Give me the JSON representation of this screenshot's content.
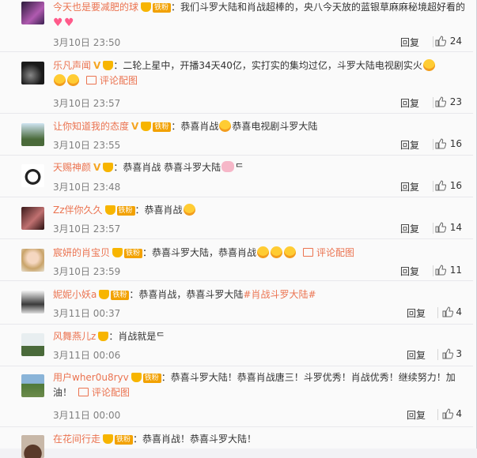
{
  "labels": {
    "reply": "回复",
    "fan_badge": "铁粉",
    "view_image": "评论配图"
  },
  "comments": [
    {
      "nick": "今天也是要减肥的球",
      "text": "：我们斗罗大陆和肖战超棒的，央八今天放的蓝银草麻麻秘境超好看的",
      "time": "3月10日 23:50",
      "likes": "24"
    },
    {
      "nick": "乐凡声闻",
      "text": "：二轮上星中，开播34天40亿，实打实的集均过亿，斗罗大陆电视剧实火",
      "time": "3月10日 23:57",
      "likes": "23"
    },
    {
      "nick": "让你知道我的态度",
      "text": "：恭喜肖战",
      "text2": "恭喜电视剧斗罗大陆",
      "time": "3月10日 23:55",
      "likes": "16"
    },
    {
      "nick": "天赐神颜",
      "text": "：恭喜肖战 恭喜斗罗大陆",
      "text2": "ᄃ",
      "time": "3月10日 23:48",
      "likes": "16"
    },
    {
      "nick": "Zz伴你久久",
      "text": "：恭喜肖战",
      "time": "3月10日 23:57",
      "likes": "14"
    },
    {
      "nick": "宸妍的肖宝贝",
      "text": "：恭喜斗罗大陆，恭喜肖战",
      "time": "3月10日 23:59",
      "likes": "11"
    },
    {
      "nick": "妮妮小妖a",
      "text": "：恭喜肖战，恭喜斗罗大陆",
      "tag": "#肖战斗罗大陆#",
      "time": "3月11日 00:37",
      "likes": "4"
    },
    {
      "nick": "风舞燕儿z",
      "text": "：肖战就是ᄃ",
      "time": "3月11日 00:06",
      "likes": "3"
    },
    {
      "nick": "用户wher0u8ryv",
      "text": "：恭喜斗罗大陆！恭喜肖战唐三！斗罗优秀！肖战优秀！继续努力！加",
      "text_cont": "油！",
      "time": "3月11日 00:00",
      "likes": "4"
    },
    {
      "nick": "在花间行走",
      "text": "：恭喜肖战！恭喜斗罗大陆！",
      "time": "",
      "likes": ""
    }
  ],
  "colors": {
    "nick": "#eb7350",
    "fan_badge": "#f2a100",
    "vip_v": "#f5a623",
    "time": "#808080"
  },
  "icons": [
    "avatar",
    "v-badge-icon",
    "crown-icon",
    "emoji-icon",
    "image-icon",
    "thumb-up-icon"
  ]
}
